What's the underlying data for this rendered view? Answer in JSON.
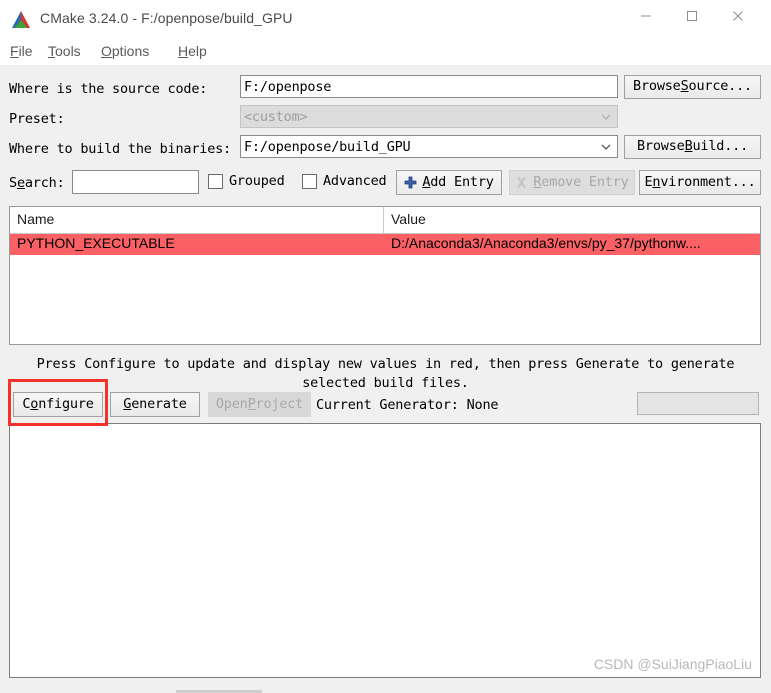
{
  "window": {
    "title": "CMake 3.24.0 - F:/openpose/build_GPU",
    "app_icon": "cmake-logo-icon",
    "controls": {
      "minimize": "minimize-icon",
      "maximize": "maximize-icon",
      "close": "close-icon"
    }
  },
  "menubar": {
    "items": [
      {
        "label": "File",
        "mnemonic": "F",
        "rest": "ile"
      },
      {
        "label": "Tools",
        "mnemonic": "T",
        "rest": "ools"
      },
      {
        "label": "Options",
        "mnemonic": "O",
        "rest": "ptions"
      },
      {
        "label": "Help",
        "mnemonic": "H",
        "rest": "elp"
      }
    ]
  },
  "paths": {
    "source_label": "Where is the source code:",
    "source_value": "F:/openpose",
    "browse_source_pre": "Browse ",
    "browse_source_mn": "S",
    "browse_source_post": "ource...",
    "preset_label": "Preset:",
    "preset_value": "<custom>",
    "preset_disabled": true,
    "build_label": "Where to build the binaries:",
    "build_value": "F:/openpose/build_GPU",
    "browse_build_pre": "Browse ",
    "browse_build_mn": "B",
    "browse_build_post": "uild..."
  },
  "toolbar": {
    "search_label_pre": "S",
    "search_label_mn": "e",
    "search_label_post": "arch:",
    "search_value": "",
    "search_placeholder": "",
    "grouped_label": "Grouped",
    "grouped_checked": false,
    "advanced_label": "Advanced",
    "advanced_checked": false,
    "add_entry_pre": "",
    "add_entry_mn": "A",
    "add_entry_post": "dd Entry",
    "add_entry_icon": "plus-icon",
    "remove_entry_pre": "",
    "remove_entry_mn": "R",
    "remove_entry_post": "emove Entry",
    "remove_entry_icon": "remove-x-icon",
    "remove_entry_disabled": true,
    "environment_pre": "E",
    "environment_mn": "n",
    "environment_post": "vironment..."
  },
  "cache_table": {
    "columns": [
      "Name",
      "Value"
    ],
    "rows": [
      {
        "name": "PYTHON_EXECUTABLE",
        "value": "D:/Anaconda3/Anaconda3/envs/py_37/pythonw....",
        "highlight_color": "#fb6164"
      }
    ]
  },
  "hint": {
    "line1": "Press Configure to update and display new values in red, then press Generate to generate",
    "line2": "selected build files."
  },
  "actions": {
    "configure_pre": "C",
    "configure_mn": "o",
    "configure_post": "nfigure",
    "generate_pre": "",
    "generate_mn": "G",
    "generate_post": "enerate",
    "open_project_pre": "Open ",
    "open_project_mn": "P",
    "open_project_post": "roject",
    "open_project_disabled": true,
    "current_generator": "Current Generator: None",
    "progress_value": 0
  },
  "output": {
    "text": "",
    "watermark": "CSDN @SuiJiangPiaoLiu"
  },
  "annotation": {
    "color": "#f3322c",
    "target": "configure-button"
  }
}
